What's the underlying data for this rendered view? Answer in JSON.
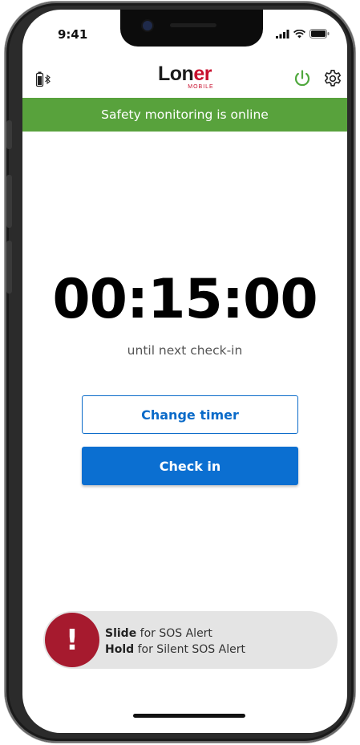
{
  "status_bar": {
    "time": "9:41"
  },
  "app_bar": {
    "logo_main_dark": "Lon",
    "logo_main_red": "er",
    "logo_sub": "MOBILE",
    "icons": [
      "bluetooth-battery-icon",
      "power-icon",
      "gear-icon"
    ]
  },
  "banner": {
    "text": "Safety monitoring is online",
    "color": "#58a23c"
  },
  "timer": {
    "value": "00:15:00",
    "caption": "until next check-in"
  },
  "buttons": {
    "change_timer": "Change timer",
    "check_in": "Check in",
    "accent": "#0b6fd1"
  },
  "sos": {
    "knob_symbol": "!",
    "line1_bold": "Slide",
    "line1_rest": " for SOS Alert",
    "line2_bold": "Hold",
    "line2_rest": " for Silent SOS Alert",
    "color": "#a61a2e"
  }
}
